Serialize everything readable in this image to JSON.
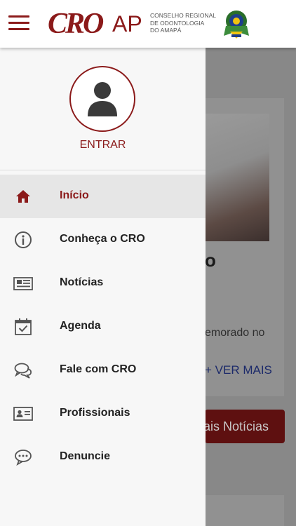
{
  "header": {
    "menu_icon": "hamburger-icon",
    "logo_main": "CRO",
    "logo_state": "AP",
    "logo_subtitle_lines": [
      "Conselho Regional",
      "de Odontologia",
      "do Amapá"
    ],
    "seal_icon": "coat-of-arms-icon"
  },
  "drawer": {
    "avatar_icon": "user-avatar-icon",
    "login_label": "ENTRAR",
    "items": [
      {
        "label": "Início",
        "icon": "home-icon",
        "active": true
      },
      {
        "label": "Conheça o CRO",
        "icon": "info-icon",
        "active": false
      },
      {
        "label": "Notícias",
        "icon": "newspaper-icon",
        "active": false
      },
      {
        "label": "Agenda",
        "icon": "calendar-check-icon",
        "active": false
      },
      {
        "label": "Fale com CRO",
        "icon": "chat-bubbles-icon",
        "active": false
      },
      {
        "label": "Profissionais",
        "icon": "id-card-icon",
        "active": false
      },
      {
        "label": "Denuncie",
        "icon": "speech-bubble-icon",
        "active": false
      }
    ]
  },
  "background": {
    "card_title_fragment": "o",
    "card_text_fragment": "emorado no",
    "card_link": "+ VER MAIS",
    "button_fragment": "ais Notícias"
  },
  "colors": {
    "brand": "#8b1a1a",
    "drawer_bg": "#f7f7f7",
    "active_item_bg": "#e6e6e6",
    "overlay": "#888888"
  }
}
